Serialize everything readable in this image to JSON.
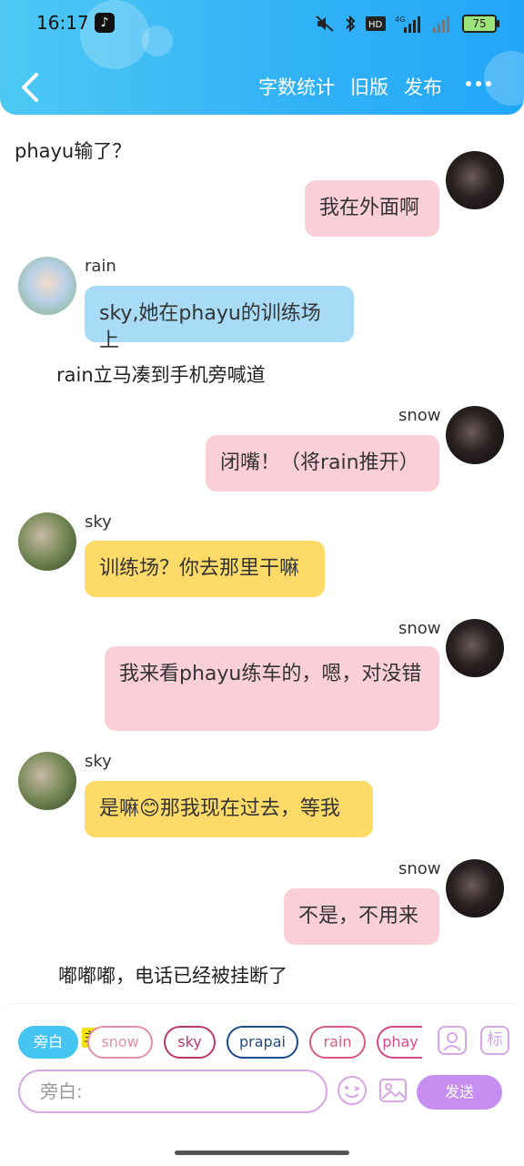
{
  "status_bar": {
    "time": "16:17",
    "network": "4G",
    "battery": "75"
  },
  "header": {
    "actions": [
      "字数统计",
      "旧版",
      "发布"
    ]
  },
  "chat": {
    "narration_top": "phayu输了？",
    "msg_me_1": "我在外面啊",
    "rain_name": "rain",
    "rain_msg": "sky,她在phayu的训练场上",
    "narration_2": "rain立马凑到手机旁喊道",
    "snow_name_1": "snow",
    "snow_msg_1": "闭嘴！（将rain推开）",
    "sky_name_1": "sky",
    "sky_msg_1": "训练场？你去那里干嘛",
    "snow_name_2": "snow",
    "snow_msg_2": "我来看phayu练车的，嗯，对没错",
    "sky_name_2": "sky",
    "sky_msg_2": "是嘛😊那我现在过去，等我",
    "snow_name_3": "snow",
    "snow_msg_3": "不是，不用来",
    "narration_3": "嘟嘟嘟，电话已经被挂断了"
  },
  "panel": {
    "chips": [
      "旁白",
      "snow",
      "sky",
      "prapai",
      "rain",
      "phay"
    ],
    "badge": "主",
    "role_icon_label": "标",
    "input_placeholder": "旁白:",
    "send_label": "发送"
  },
  "colors": {
    "header_gradient_start": "#4ec8f3",
    "header_gradient_end": "#22a6f7",
    "bubble_blue": "#a8dcf6",
    "bubble_yellow": "#fedb68",
    "bubble_pink": "#fbcfd8",
    "send_purple": "#c58ef0"
  }
}
